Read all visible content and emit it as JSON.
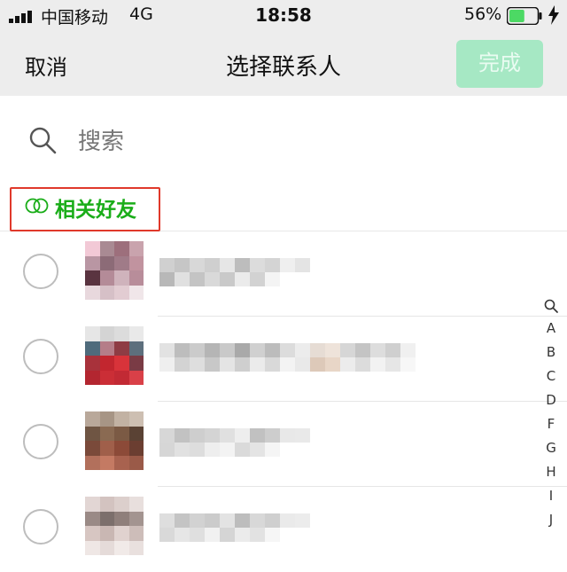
{
  "status_bar": {
    "carrier": "中国移动",
    "network": "4G",
    "time": "18:58",
    "battery": "56%",
    "battery_level": 0.56,
    "battery_color": "#4cd964"
  },
  "nav": {
    "cancel": "取消",
    "title": "选择联系人",
    "done": "完成"
  },
  "search": {
    "placeholder": "搜索"
  },
  "related": {
    "label": "相关好友",
    "color": "#1aad19"
  },
  "contacts_count_visible": 4,
  "index_bar": [
    "A",
    "B",
    "C",
    "D",
    "F",
    "G",
    "H",
    "I",
    "J"
  ]
}
